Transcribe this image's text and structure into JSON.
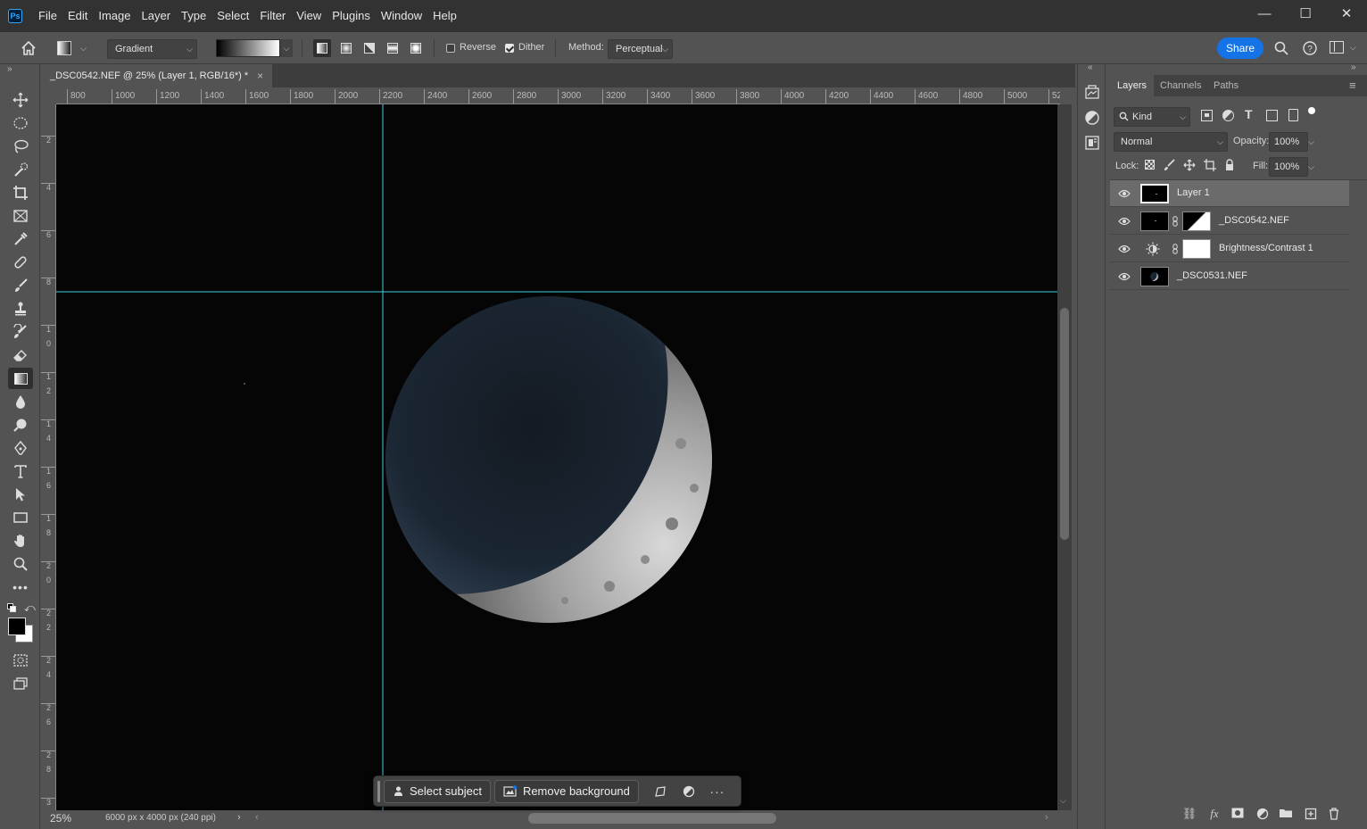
{
  "app": {
    "logo": "Ps"
  },
  "menu": [
    "File",
    "Edit",
    "Image",
    "Layer",
    "Type",
    "Select",
    "Filter",
    "View",
    "Plugins",
    "Window",
    "Help"
  ],
  "window_controls": {
    "minimize": "—",
    "maximize": "☐",
    "close": "✕"
  },
  "options_bar": {
    "preset": "Gradient",
    "reverse_label": "Reverse",
    "reverse_checked": false,
    "dither_label": "Dither",
    "dither_checked": true,
    "method_label": "Method:",
    "method_value": "Perceptual",
    "share_label": "Share"
  },
  "document": {
    "tab_title": "_DSC0542.NEF @ 25% (Layer 1, RGB/16*) *",
    "close_glyph": "×",
    "ruler_top": [
      "800",
      "1000",
      "1200",
      "1400",
      "1600",
      "1800",
      "2000",
      "2200",
      "2400",
      "2600",
      "2800",
      "3000",
      "3200",
      "3400",
      "3600",
      "3800",
      "4000",
      "4200",
      "4400",
      "4600",
      "4800",
      "5000",
      "52"
    ],
    "ruler_left": [
      "2",
      "4",
      "6",
      "8",
      "1 0",
      "1 2",
      "1 4",
      "1 6",
      "1 8",
      "2 0",
      "2 2",
      "2 4",
      "2 6",
      "2 8",
      "3"
    ],
    "zoom": "25%",
    "doc_info": "6000 px x 4000 px (240 ppi)"
  },
  "task_bar": {
    "select_subject": "Select subject",
    "remove_background": "Remove background",
    "more": "···"
  },
  "layers_panel": {
    "tabs": [
      "Layers",
      "Channels",
      "Paths"
    ],
    "filter_kind": "Kind",
    "blend_mode": "Normal",
    "opacity_label": "Opacity:",
    "opacity_value": "100%",
    "lock_label": "Lock:",
    "fill_label": "Fill:",
    "fill_value": "100%",
    "layers": [
      {
        "name": "Layer 1",
        "selected": true
      },
      {
        "name": "_DSC0542.NEF",
        "selected": false
      },
      {
        "name": "Brightness/Contrast 1",
        "selected": false
      },
      {
        "name": "_DSC0531.NEF",
        "selected": false
      }
    ]
  },
  "colors": {
    "accent": "#1473e6",
    "guide": "#3fd0e0",
    "panel_bg": "#535353",
    "canvas_bg": "#050505"
  }
}
